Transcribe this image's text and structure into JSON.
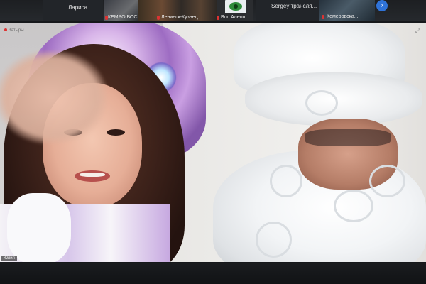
{
  "thumbnails": [
    {
      "name": "Лариса"
    },
    {
      "name": "КЕМРО ВОС"
    },
    {
      "name": "Ленинск-Кузнец"
    },
    {
      "name": "Вос Алеоп"
    },
    {
      "name": "Sergey  трансля..."
    },
    {
      "name": "Кемеровска..."
    }
  ],
  "next_button": "›",
  "main_video": {
    "top_tag": "Затыры",
    "bottom_tag": "Юлия",
    "exit_icon": "⤢"
  },
  "colors": {
    "accent": "#2f73d8",
    "mic_muted": "#d33333",
    "logo_green": "#2e8b3a"
  },
  "icons": [
    "muted-mic-icon",
    "next-page-icon",
    "fullscreen-icon",
    "eye-logo-icon"
  ]
}
